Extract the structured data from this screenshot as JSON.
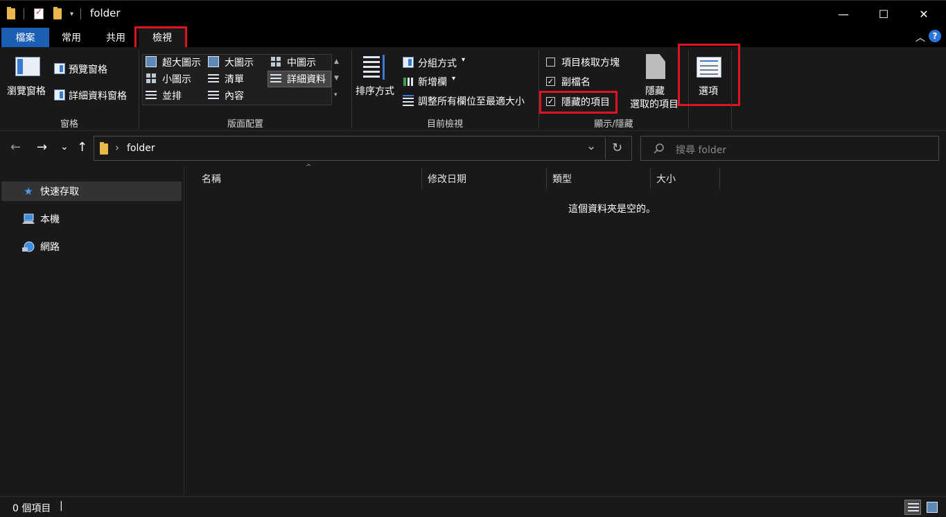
{
  "window": {
    "title": "folder",
    "minimize_glyph": "—",
    "maximize_glyph": "☐",
    "close_glyph": "✕"
  },
  "ribbon_tabs": {
    "file": "檔案",
    "home": "常用",
    "share": "共用",
    "view": "檢視",
    "active": "檢視"
  },
  "ribbon": {
    "panes": {
      "navigation_pane": "瀏覽窗格",
      "preview_pane": "預覽窗格",
      "details_pane": "詳細資料窗格",
      "group_label": "窗格"
    },
    "layout": {
      "extra_large_icons": "超大圖示",
      "large_icons": "大圖示",
      "medium_icons": "中圖示",
      "small_icons": "小圖示",
      "list": "清單",
      "details": "詳細資料",
      "tiles": "並排",
      "content": "內容",
      "selected": "詳細資料",
      "group_label": "版面配置"
    },
    "current_view": {
      "sort_by": "排序方式",
      "group_by": "分組方式",
      "add_columns": "新增欄",
      "size_all_columns": "調整所有欄位至最適大小",
      "group_label": "目前檢視"
    },
    "show_hide": {
      "item_check_boxes": "項目核取方塊",
      "item_check_boxes_checked": false,
      "file_name_extensions": "副檔名",
      "file_name_extensions_checked": true,
      "hidden_items": "隱藏的項目",
      "hidden_items_checked": true,
      "hide_selected_line1": "隱藏",
      "hide_selected_line2": "選取的項目",
      "group_label": "顯示/隱藏"
    },
    "options": {
      "label": "選項"
    }
  },
  "navigation": {
    "back": "←",
    "forward": "→",
    "recent": "⌄",
    "up": "↑",
    "breadcrumb_separator": "›",
    "path": "folder",
    "dropdown": "⌄",
    "refresh": "↻",
    "search_placeholder": "搜尋 folder"
  },
  "sidebar": {
    "items": [
      {
        "label": "快速存取",
        "icon": "star-icon"
      },
      {
        "label": "本機",
        "icon": "computer-icon"
      },
      {
        "label": "網路",
        "icon": "network-icon"
      }
    ],
    "selected_index": 0
  },
  "file_list": {
    "columns": [
      "名稱",
      "修改日期",
      "類型",
      "大小"
    ],
    "sort_indicator": "^",
    "empty_message": "這個資料夾是空的。"
  },
  "status_bar": {
    "item_count": "0 個項目",
    "separator": "|"
  },
  "colors": {
    "accent_blue": "#1a5fb4",
    "highlight_red": "#e0141e",
    "background": "#191919",
    "titlebar": "#000000",
    "folder_yellow": "#e8b84b"
  }
}
